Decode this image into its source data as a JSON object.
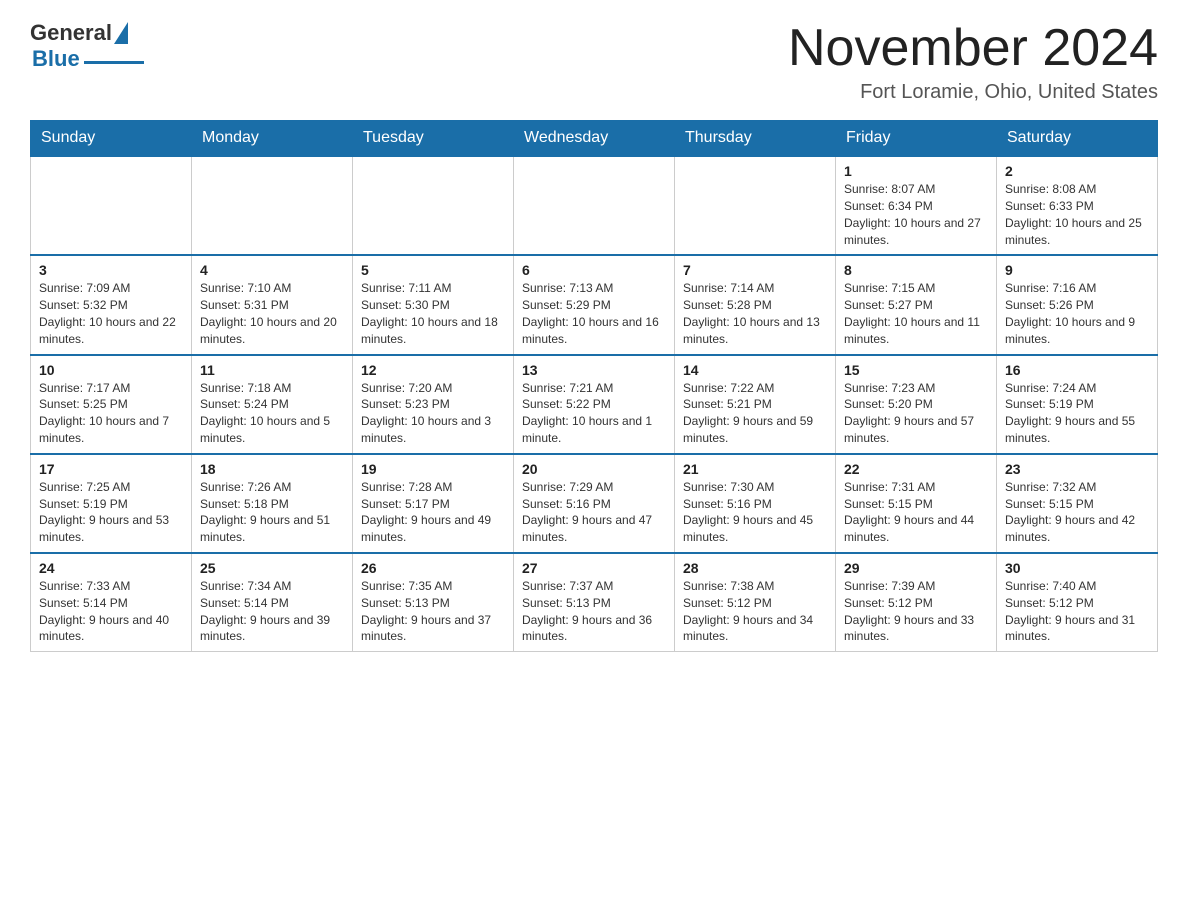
{
  "header": {
    "logo_general": "General",
    "logo_blue": "Blue",
    "month_title": "November 2024",
    "location": "Fort Loramie, Ohio, United States"
  },
  "weekdays": [
    "Sunday",
    "Monday",
    "Tuesday",
    "Wednesday",
    "Thursday",
    "Friday",
    "Saturday"
  ],
  "weeks": [
    [
      {
        "day": "",
        "info": ""
      },
      {
        "day": "",
        "info": ""
      },
      {
        "day": "",
        "info": ""
      },
      {
        "day": "",
        "info": ""
      },
      {
        "day": "",
        "info": ""
      },
      {
        "day": "1",
        "info": "Sunrise: 8:07 AM\nSunset: 6:34 PM\nDaylight: 10 hours and 27 minutes."
      },
      {
        "day": "2",
        "info": "Sunrise: 8:08 AM\nSunset: 6:33 PM\nDaylight: 10 hours and 25 minutes."
      }
    ],
    [
      {
        "day": "3",
        "info": "Sunrise: 7:09 AM\nSunset: 5:32 PM\nDaylight: 10 hours and 22 minutes."
      },
      {
        "day": "4",
        "info": "Sunrise: 7:10 AM\nSunset: 5:31 PM\nDaylight: 10 hours and 20 minutes."
      },
      {
        "day": "5",
        "info": "Sunrise: 7:11 AM\nSunset: 5:30 PM\nDaylight: 10 hours and 18 minutes."
      },
      {
        "day": "6",
        "info": "Sunrise: 7:13 AM\nSunset: 5:29 PM\nDaylight: 10 hours and 16 minutes."
      },
      {
        "day": "7",
        "info": "Sunrise: 7:14 AM\nSunset: 5:28 PM\nDaylight: 10 hours and 13 minutes."
      },
      {
        "day": "8",
        "info": "Sunrise: 7:15 AM\nSunset: 5:27 PM\nDaylight: 10 hours and 11 minutes."
      },
      {
        "day": "9",
        "info": "Sunrise: 7:16 AM\nSunset: 5:26 PM\nDaylight: 10 hours and 9 minutes."
      }
    ],
    [
      {
        "day": "10",
        "info": "Sunrise: 7:17 AM\nSunset: 5:25 PM\nDaylight: 10 hours and 7 minutes."
      },
      {
        "day": "11",
        "info": "Sunrise: 7:18 AM\nSunset: 5:24 PM\nDaylight: 10 hours and 5 minutes."
      },
      {
        "day": "12",
        "info": "Sunrise: 7:20 AM\nSunset: 5:23 PM\nDaylight: 10 hours and 3 minutes."
      },
      {
        "day": "13",
        "info": "Sunrise: 7:21 AM\nSunset: 5:22 PM\nDaylight: 10 hours and 1 minute."
      },
      {
        "day": "14",
        "info": "Sunrise: 7:22 AM\nSunset: 5:21 PM\nDaylight: 9 hours and 59 minutes."
      },
      {
        "day": "15",
        "info": "Sunrise: 7:23 AM\nSunset: 5:20 PM\nDaylight: 9 hours and 57 minutes."
      },
      {
        "day": "16",
        "info": "Sunrise: 7:24 AM\nSunset: 5:19 PM\nDaylight: 9 hours and 55 minutes."
      }
    ],
    [
      {
        "day": "17",
        "info": "Sunrise: 7:25 AM\nSunset: 5:19 PM\nDaylight: 9 hours and 53 minutes."
      },
      {
        "day": "18",
        "info": "Sunrise: 7:26 AM\nSunset: 5:18 PM\nDaylight: 9 hours and 51 minutes."
      },
      {
        "day": "19",
        "info": "Sunrise: 7:28 AM\nSunset: 5:17 PM\nDaylight: 9 hours and 49 minutes."
      },
      {
        "day": "20",
        "info": "Sunrise: 7:29 AM\nSunset: 5:16 PM\nDaylight: 9 hours and 47 minutes."
      },
      {
        "day": "21",
        "info": "Sunrise: 7:30 AM\nSunset: 5:16 PM\nDaylight: 9 hours and 45 minutes."
      },
      {
        "day": "22",
        "info": "Sunrise: 7:31 AM\nSunset: 5:15 PM\nDaylight: 9 hours and 44 minutes."
      },
      {
        "day": "23",
        "info": "Sunrise: 7:32 AM\nSunset: 5:15 PM\nDaylight: 9 hours and 42 minutes."
      }
    ],
    [
      {
        "day": "24",
        "info": "Sunrise: 7:33 AM\nSunset: 5:14 PM\nDaylight: 9 hours and 40 minutes."
      },
      {
        "day": "25",
        "info": "Sunrise: 7:34 AM\nSunset: 5:14 PM\nDaylight: 9 hours and 39 minutes."
      },
      {
        "day": "26",
        "info": "Sunrise: 7:35 AM\nSunset: 5:13 PM\nDaylight: 9 hours and 37 minutes."
      },
      {
        "day": "27",
        "info": "Sunrise: 7:37 AM\nSunset: 5:13 PM\nDaylight: 9 hours and 36 minutes."
      },
      {
        "day": "28",
        "info": "Sunrise: 7:38 AM\nSunset: 5:12 PM\nDaylight: 9 hours and 34 minutes."
      },
      {
        "day": "29",
        "info": "Sunrise: 7:39 AM\nSunset: 5:12 PM\nDaylight: 9 hours and 33 minutes."
      },
      {
        "day": "30",
        "info": "Sunrise: 7:40 AM\nSunset: 5:12 PM\nDaylight: 9 hours and 31 minutes."
      }
    ]
  ]
}
